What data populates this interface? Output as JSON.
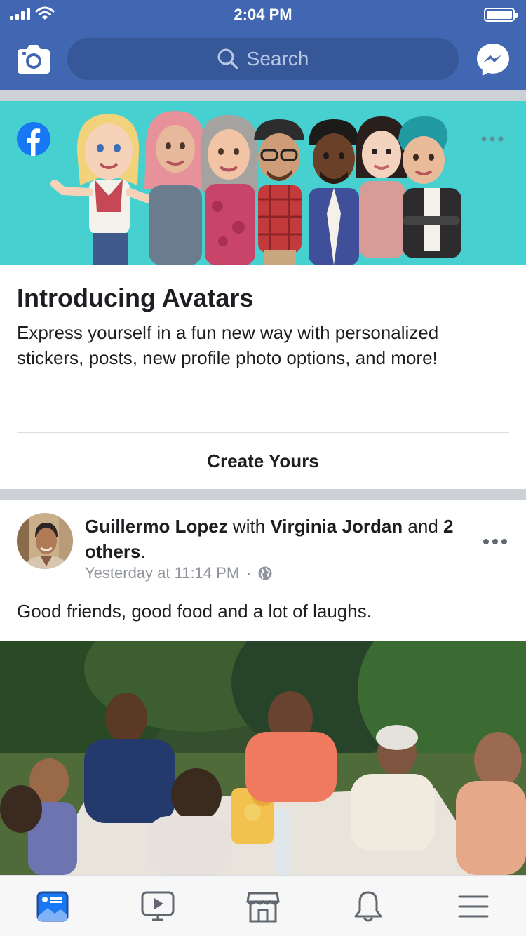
{
  "status_bar": {
    "time": "2:04 PM"
  },
  "header": {
    "search_placeholder": "Search"
  },
  "avatars_card": {
    "title": "Introducing Avatars",
    "description": "Express yourself in a fun new way with personalized stickers, posts, new profile photo options, and more!",
    "cta": "Create Yours"
  },
  "post": {
    "author": "Guillermo Lopez",
    "with_text": " with ",
    "tagged_person": "Virginia Jordan",
    "and_text": " and ",
    "others": "2 others",
    "period": ".",
    "timestamp": "Yesterday at 11:14 PM",
    "dot": "·",
    "text": "Good friends, good food and a lot of laughs."
  },
  "tabbar": {
    "tabs": [
      "news-feed",
      "watch",
      "marketplace",
      "notifications",
      "menu"
    ],
    "active": "news-feed"
  },
  "colors": {
    "brand": "#4267b2",
    "search_bg": "#365899",
    "banner": "#46d1d0",
    "separator": "#cdd0d4",
    "text": "#1c1e21",
    "muted": "#90949c"
  }
}
